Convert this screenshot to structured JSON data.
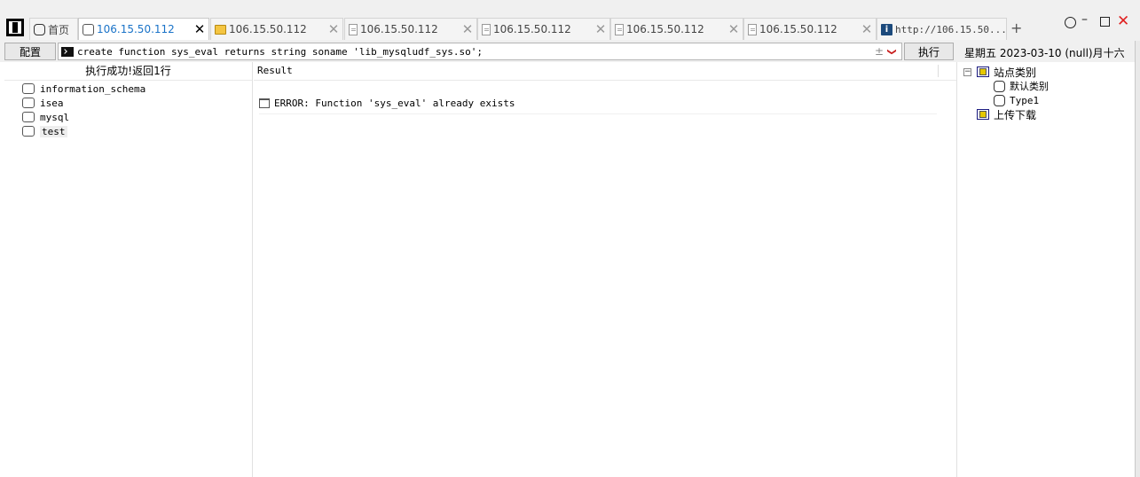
{
  "tabs": [
    {
      "label": "首页",
      "icon": "home-icon",
      "closable": false
    },
    {
      "label": "106.15.50.112",
      "icon": "database-icon",
      "active": true
    },
    {
      "label": "106.15.50.112",
      "icon": "folder-icon"
    },
    {
      "label": "106.15.50.112",
      "icon": "document-icon"
    },
    {
      "label": "106.15.50.112",
      "icon": "document-icon"
    },
    {
      "label": "106.15.50.112",
      "icon": "document-icon"
    },
    {
      "label": "106.15.50.112",
      "icon": "document-icon"
    },
    {
      "label": "http://106.15.50...",
      "icon": "info-icon"
    }
  ],
  "toolbar": {
    "config_label": "配置",
    "sql_value": "create function sys_eval returns string soname 'lib_mysqludf_sys.so';",
    "history_glyph": "±",
    "dropdown_glyph": "❯",
    "execute_label": "执行",
    "datetime": "星期五 2023-03-10 (null)月十六"
  },
  "left_panel": {
    "header": "执行成功!返回1行",
    "databases": [
      "information_schema",
      "isea",
      "mysql",
      "test"
    ],
    "selected": "test"
  },
  "result_panel": {
    "header": "Result",
    "rows": [
      "ERROR: Function 'sys_eval' already exists"
    ]
  },
  "sidebar": {
    "site_category": {
      "label": "站点类别",
      "children": [
        "默认类别",
        "Type1"
      ]
    },
    "upload_download": "上传下载"
  },
  "window": {
    "new_tab": "+",
    "minimize": "–",
    "close": "✕"
  }
}
